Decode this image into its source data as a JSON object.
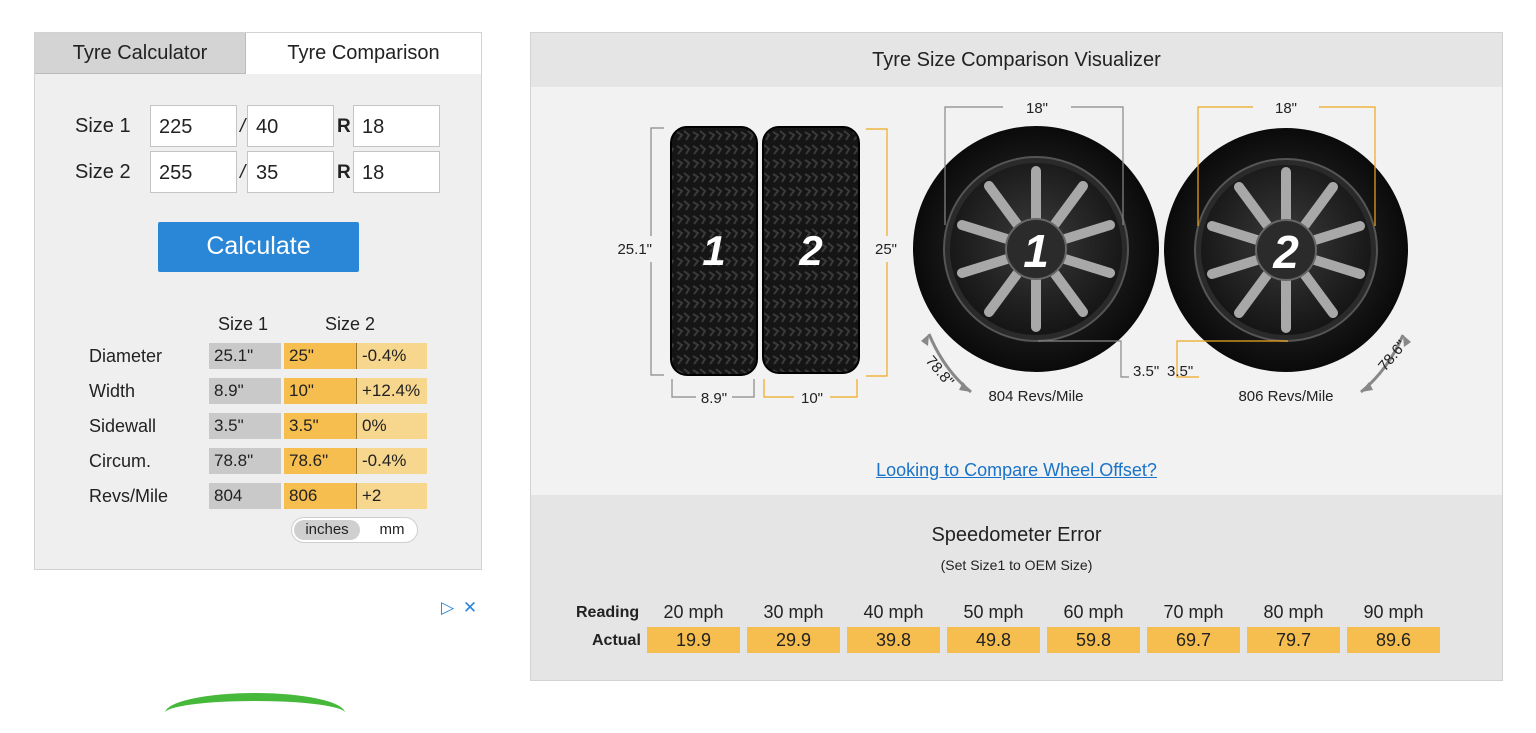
{
  "tabs": {
    "calculator": "Tyre Calculator",
    "comparison": "Tyre Comparison"
  },
  "inputs": {
    "size1": {
      "label": "Size 1",
      "width": "225",
      "aspect": "40",
      "rim": "18"
    },
    "size2": {
      "label": "Size 2",
      "width": "255",
      "aspect": "35",
      "rim": "18"
    },
    "slash": "/",
    "r": "R"
  },
  "calculate_label": "Calculate",
  "results": {
    "headers": {
      "size1": "Size 1",
      "size2": "Size 2"
    },
    "rows": [
      {
        "label": "Diameter",
        "s1": "25.1\"",
        "s2": "25\"",
        "diff": "-0.4%"
      },
      {
        "label": "Width",
        "s1": "8.9\"",
        "s2": "10\"",
        "diff": "+12.4%"
      },
      {
        "label": "Sidewall",
        "s1": "3.5\"",
        "s2": "3.5\"",
        "diff": "0%"
      },
      {
        "label": "Circum.",
        "s1": "78.8\"",
        "s2": "78.6\"",
        "diff": "-0.4%"
      },
      {
        "label": "Revs/Mile",
        "s1": "804",
        "s2": "806",
        "diff": "+2"
      }
    ]
  },
  "units": {
    "inches": "inches",
    "mm": "mm",
    "selected": "inches"
  },
  "ad": {
    "icons": [
      "adchoices-icon",
      "close-icon"
    ]
  },
  "visualizer": {
    "title": "Tyre Size Comparison Visualizer",
    "tyre1": {
      "number": "1",
      "diameter": "25.1\"",
      "width": "8.9\"",
      "rim": "18\"",
      "circumference": "78.8\"",
      "sidewall": "3.5\"",
      "revs": "804 Revs/Mile"
    },
    "tyre2": {
      "number": "2",
      "diameter": "25\"",
      "width": "10\"",
      "rim": "18\"",
      "circumference": "78.6\"",
      "sidewall": "3.5\"",
      "revs": "806 Revs/Mile"
    },
    "offset_link": "Looking to Compare Wheel Offset?"
  },
  "speedometer": {
    "title": "Speedometer Error",
    "note": "(Set Size1 to OEM Size)",
    "reading_label": "Reading",
    "actual_label": "Actual",
    "readings": [
      "20 mph",
      "30 mph",
      "40 mph",
      "50 mph",
      "60 mph",
      "70 mph",
      "80 mph",
      "90 mph"
    ],
    "actuals": [
      "19.9",
      "29.9",
      "39.8",
      "49.8",
      "59.8",
      "69.7",
      "79.7",
      "89.6"
    ]
  },
  "colors": {
    "size2_accent": "#f6be4f",
    "size1_neutral": "#c9c9c9",
    "button": "#2a87d8",
    "link": "#1a73c8"
  }
}
